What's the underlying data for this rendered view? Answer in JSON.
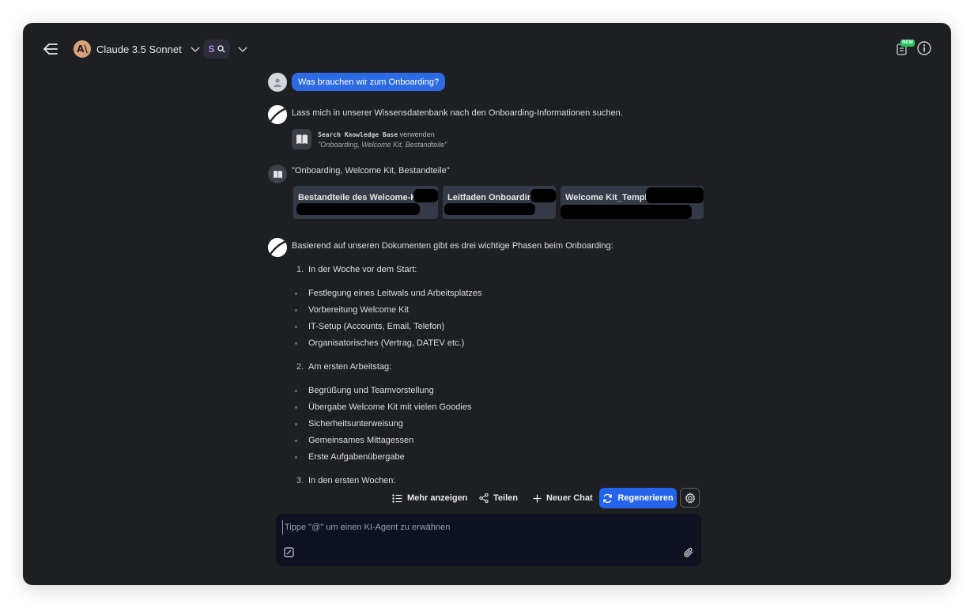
{
  "topbar": {
    "model_initials": "A\\",
    "model_name": "Claude 3.5 Sonnet",
    "agent_letter": "S",
    "new_badge": "NEW"
  },
  "user_message": {
    "text": "Was brauchen wir zum Onboarding?"
  },
  "assistant_intro": {
    "text": "Lass mich in unserer Wissensdatenbank nach den Onboarding-Informationen suchen."
  },
  "tool_call": {
    "tool_name": "Search Knowledge Base",
    "verb": "verwenden",
    "query": "\"Onboarding, Welcome Kit, Bestandteile\""
  },
  "knowledge_result": {
    "query": "\"Onboarding, Welcome Kit, Bestandteile\"",
    "sources": [
      {
        "title": "Bestandteile des Welcome-Kits"
      },
      {
        "title": "Leitfaden Onboarding"
      },
      {
        "title": "Welcome Kit_Templat"
      }
    ]
  },
  "answer": {
    "intro": "Basierend auf unseren Dokumenten gibt es drei wichtige Phasen beim Onboarding:",
    "phases": [
      {
        "number": "1.",
        "title": "In der Woche vor dem Start:",
        "items": [
          "Festlegung eines Leitwals und Arbeitsplatzes",
          "Vorbereitung Welcome Kit",
          "IT-Setup (Accounts, Email, Telefon)",
          "Organisatorisches (Vertrag, DATEV etc.)"
        ]
      },
      {
        "number": "2.",
        "title": "Am ersten Arbeitstag:",
        "items": [
          "Begrüßung und Teamvorstellung",
          "Übergabe Welcome Kit mit vielen Goodies",
          "Sicherheitsunterweisung",
          "Gemeinsames Mittagessen",
          "Erste Aufgabenübergabe"
        ]
      },
      {
        "number": "3.",
        "title": "In den ersten Wochen:",
        "items": []
      }
    ]
  },
  "actions": {
    "show_more": "Mehr anzeigen",
    "share": "Teilen",
    "new_chat": "Neuer Chat",
    "regenerate": "Regenerieren"
  },
  "composer": {
    "placeholder": "Tippe \"@\" um einen KI-Agent zu erwähnen",
    "value": ""
  },
  "colors": {
    "window_bg": "#1e1f22",
    "accent": "#2563eb",
    "user_bubble": "#2d6be4",
    "composer_bg": "#0e1220"
  }
}
